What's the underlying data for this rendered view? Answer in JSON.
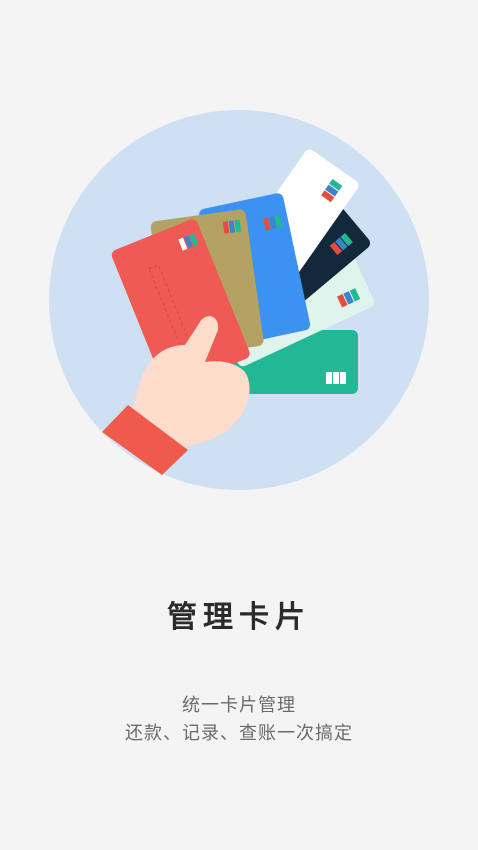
{
  "illustration": {
    "icon": "hand-holding-cards-illustration",
    "colors": {
      "circle": "#cfe0f3",
      "sleeve": "#f05a4b",
      "hand": "#fddccb",
      "cards": [
        "#23b894",
        "#def4ec",
        "#12293c",
        "#ffffff",
        "#3c92f0",
        "#b4a264",
        "#f05a55"
      ]
    }
  },
  "onboarding": {
    "title": "管理卡片",
    "description_line1": "统一卡片管理",
    "description_line2": "还款、记录、查账一次搞定"
  }
}
